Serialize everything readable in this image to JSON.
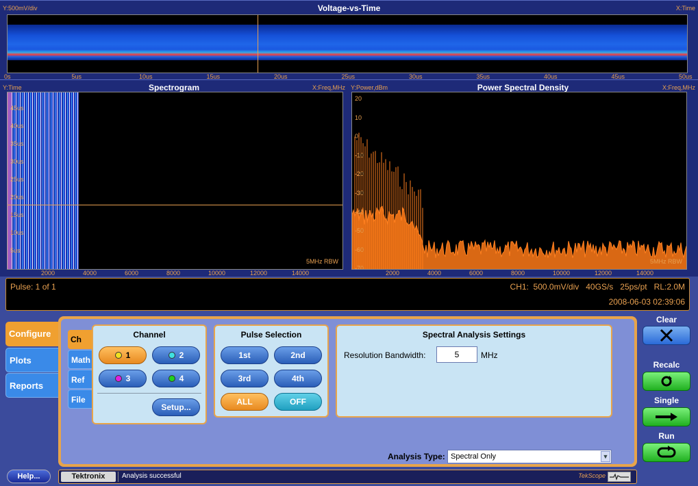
{
  "top_panel": {
    "title": "Voltage-vs-Time",
    "y_label": "Y:500mV/div",
    "x_label": "X:Time",
    "x_ticks": [
      "0s",
      "5us",
      "10us",
      "15us",
      "20us",
      "25us",
      "30us",
      "35us",
      "40us",
      "45us",
      "50us"
    ]
  },
  "spectrogram": {
    "title": "Spectrogram",
    "y_label": "Y:Time",
    "x_label": "X:Freq,MHz",
    "y_ticks": [
      "45us",
      "40us",
      "35us",
      "30us",
      "25us",
      "20us",
      "15us",
      "10us",
      "5us"
    ],
    "x_ticks": [
      "2000",
      "4000",
      "6000",
      "8000",
      "10000",
      "12000",
      "14000"
    ],
    "rbw": "5MHz RBW"
  },
  "psd": {
    "title": "Power Spectral Density",
    "y_label": "Y:Power,dBm",
    "x_label": "X:Freq,MHz",
    "y_ticks": [
      "20",
      "10",
      "0",
      "-10",
      "-20",
      "-30",
      "-40",
      "-50",
      "-60",
      "-70"
    ],
    "x_ticks": [
      "2000",
      "4000",
      "6000",
      "8000",
      "10000",
      "12000",
      "14000"
    ],
    "rbw": "5MHz RBW"
  },
  "infobar": {
    "pulse": "Pulse: 1 of 1",
    "settings": "CH1:  500.0mV/div   40GS/s   25ps/pt   RL:2.0M",
    "datetime": "2008-06-03 02:39:06"
  },
  "left_tabs": [
    "Configure",
    "Plots",
    "Reports"
  ],
  "sub_tabs": [
    "Ch",
    "Math",
    "Ref",
    "File"
  ],
  "channel": {
    "title": "Channel",
    "buttons": [
      {
        "label": "1",
        "color": "#f0e020"
      },
      {
        "label": "2",
        "color": "#40e0e0"
      },
      {
        "label": "3",
        "color": "#e020e0"
      },
      {
        "label": "4",
        "color": "#20d020"
      }
    ],
    "setup": "Setup..."
  },
  "pulse_selection": {
    "title": "Pulse Selection",
    "buttons": [
      "1st",
      "2nd",
      "3rd",
      "4th",
      "ALL",
      "OFF"
    ]
  },
  "spectral": {
    "title": "Spectral Analysis Settings",
    "rbw_label": "Resolution Bandwidth:",
    "rbw_value": "5",
    "rbw_unit": "MHz"
  },
  "analysis_type": {
    "label": "Analysis Type:",
    "value": "Spectral Only"
  },
  "right_buttons": {
    "clear": "Clear",
    "recalc": "Recalc",
    "single": "Single",
    "run": "Run"
  },
  "status": {
    "help": "Help...",
    "brand": "Tektronix",
    "message": "Analysis successful",
    "app": "TekScope"
  },
  "colors": {
    "accent_orange": "#e8a44a",
    "panel_blue": "#7f8fd6",
    "trace_orange": "#ff8020"
  }
}
